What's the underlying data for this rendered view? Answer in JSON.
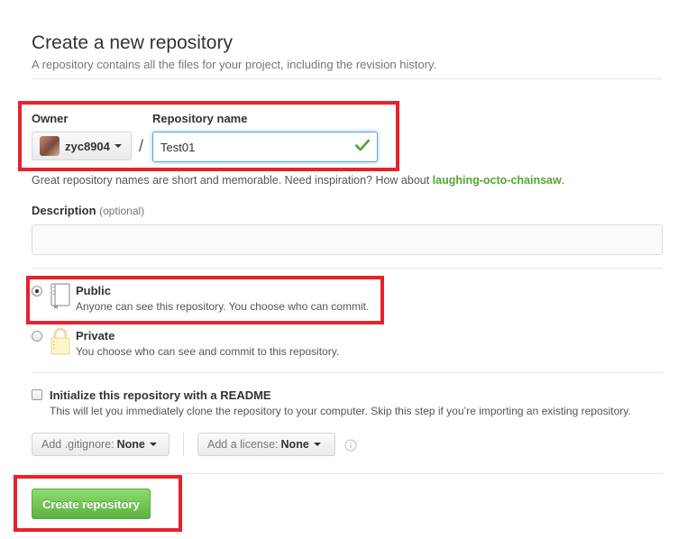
{
  "header": {
    "title": "Create a new repository",
    "subtitle": "A repository contains all the files for your project, including the revision history."
  },
  "owner": {
    "label": "Owner",
    "name": "zyc8904"
  },
  "repo": {
    "label": "Repository name",
    "value": "Test01"
  },
  "slash": "/",
  "hint": {
    "prefix": "Great repository names are short and memorable. Need inspiration? How about ",
    "suggestion": "laughing-octo-chainsaw",
    "suffix": "."
  },
  "description": {
    "label": "Description",
    "optional": "(optional)",
    "value": ""
  },
  "visibility": {
    "public": {
      "title": "Public",
      "desc": "Anyone can see this repository. You choose who can commit.",
      "selected": true
    },
    "private": {
      "title": "Private",
      "desc": "You choose who can see and commit to this repository.",
      "selected": false
    }
  },
  "readme": {
    "title": "Initialize this repository with a README",
    "desc": "This will let you immediately clone the repository to your computer. Skip this step if you’re importing an existing repository.",
    "checked": false
  },
  "gitignore": {
    "prefix": "Add .gitignore:",
    "value": "None"
  },
  "license": {
    "prefix": "Add a license:",
    "value": "None"
  },
  "submit": {
    "label": "Create repository"
  },
  "colors": {
    "highlight": "#e8212b",
    "accent_green": "#55a532",
    "button_green": "#6cc644",
    "focus_blue": "#51a7e8"
  }
}
